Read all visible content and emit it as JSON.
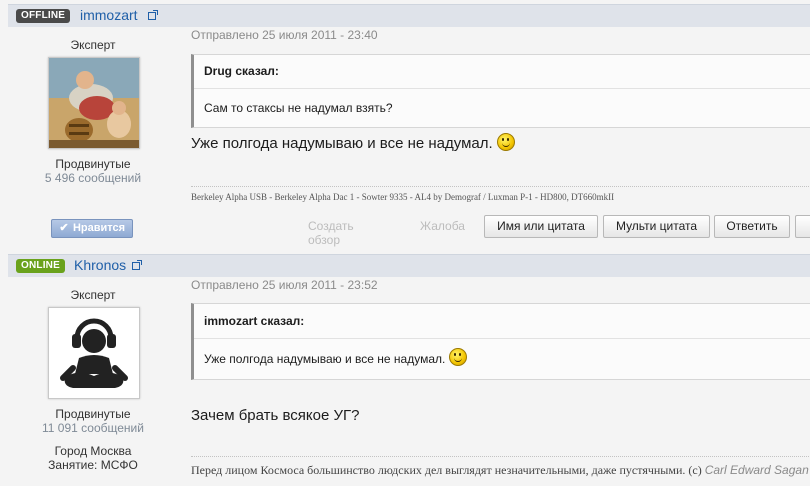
{
  "posts": [
    {
      "status": "OFFLINE",
      "username": "immozart",
      "rank": "Эксперт",
      "group": "Продвинутые",
      "posts_count": "5 496 сообщений",
      "date": "Отправлено 25 июля 2011 - 23:40",
      "quote_author": "Drug сказал:",
      "quote_text": "Сам то стаксы не надумал взять?",
      "text": "Уже полгода надумываю и все не надумал.",
      "signature": "Berkeley Alpha USB - Berkeley Alpha Dac 1 - Sowter 9335 - AL4 by Demograf / Luxman P-1 - HD800, DT660mkII",
      "like_label": "Нравится",
      "actions": {
        "review": "Создать обзор",
        "report": "Жалоба",
        "quote_name": "Имя или цитата",
        "multi_quote": "Мульти цитата",
        "reply": "Ответить"
      }
    },
    {
      "status": "ONLINE",
      "username": "Khronos",
      "rank": "Эксперт",
      "group": "Продвинутые",
      "posts_count": "11 091 сообщений",
      "city": "Город Москва",
      "occupation": "Занятие: МСФО",
      "date": "Отправлено 25 июля 2011 - 23:52",
      "quote_author": "immozart сказал:",
      "quote_text": "Уже полгода надумываю и все не надумал.",
      "text": "Зачем брать всякое УГ?",
      "signature": "Перед лицом Космоса большинство людских дел выглядят незначительными, даже пустячными. (c)",
      "signature_author": "Carl Edward Sagan"
    }
  ],
  "icons": {
    "smiley": "smiley-icon",
    "external": "external-link-icon",
    "check": "checkmark-icon"
  },
  "colors": {
    "offline": "#4a4a4a",
    "online": "#6aa21c",
    "link": "#1f5fa8",
    "like": "#8ea9d3"
  }
}
